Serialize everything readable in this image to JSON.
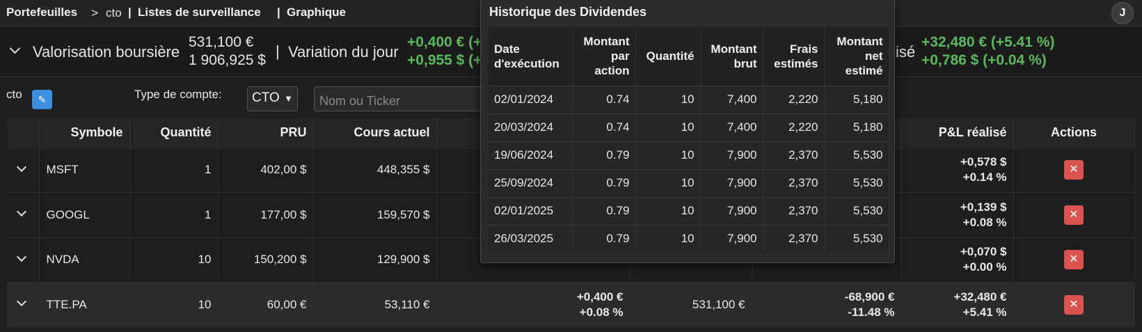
{
  "nav": {
    "portfolios": "Portefeuilles",
    "breadcrumb_sep": ">",
    "current": "cto",
    "divider": "|",
    "watchlists": "Listes de surveillance",
    "chart": "Graphique",
    "avatar": "J"
  },
  "summary": {
    "valuation_label": "Valorisation boursière",
    "valuation_eur": "531,100 €",
    "valuation_usd": "1 906,925 $",
    "divider": "|",
    "day_change_label": "Variation du jour",
    "day_change_eur": "+0,400 € (+",
    "day_change_usd": "+0,955 $ (+",
    "realized_label_tail": "isé",
    "realized_eur": "+32,480 € (+5.41 %)",
    "realized_usd": "+0,786 $ (+0.04 %)"
  },
  "filters": {
    "portfolio_name": "cto",
    "edit_icon": "pencil-icon",
    "account_type_label": "Type de compte:",
    "account_type_value": "CTO",
    "search_placeholder": "Nom ou Ticker"
  },
  "table": {
    "headers": {
      "symbol": "Symbole",
      "quantity": "Quantité",
      "pru": "PRU",
      "price": "Cours actuel",
      "realized": "P&L réalisé",
      "actions": "Actions"
    },
    "rows": [
      {
        "symbol": "MSFT",
        "quantity": "1",
        "pru": "402,00 $",
        "price": "448,355 $",
        "realized_1": "+0,578 $",
        "realized_2": "+0.14 %"
      },
      {
        "symbol": "GOOGL",
        "quantity": "1",
        "pru": "177,00 $",
        "price": "159,570 $",
        "realized_1": "+0,139 $",
        "realized_2": "+0.08 %"
      },
      {
        "symbol": "NVDA",
        "quantity": "10",
        "pru": "150,200 $",
        "price": "129,900 $",
        "realized_1": "+0,070 $",
        "realized_2": "+0.00 %"
      },
      {
        "symbol": "TTE.PA",
        "quantity": "10",
        "pru": "60,00 €",
        "price": "53,110 €",
        "day_1": "+0,400 €",
        "day_2": "+0.08 %",
        "value": "531,100 €",
        "unrealized_1": "-68,900 €",
        "unrealized_2": "-11.48 %",
        "realized_1": "+32,480 €",
        "realized_2": "+5.41 %"
      }
    ],
    "delete_glyph": "✕"
  },
  "dividends": {
    "title": "Historique des Dividendes",
    "headers": {
      "date_1": "Date",
      "date_2": "d'exécution",
      "per_share_1": "Montant",
      "per_share_2": "par",
      "per_share_3": "action",
      "quantity": "Quantité",
      "gross_1": "Montant",
      "gross_2": "brut",
      "fees_1": "Frais",
      "fees_2": "estimés",
      "net_1": "Montant",
      "net_2": "net",
      "net_3": "estimé"
    },
    "rows": [
      {
        "date": "02/01/2024",
        "per_share": "0.74",
        "quantity": "10",
        "gross": "7,400",
        "fees": "2,220",
        "net": "5,180"
      },
      {
        "date": "20/03/2024",
        "per_share": "0.74",
        "quantity": "10",
        "gross": "7,400",
        "fees": "2,220",
        "net": "5,180"
      },
      {
        "date": "19/06/2024",
        "per_share": "0.79",
        "quantity": "10",
        "gross": "7,900",
        "fees": "2,370",
        "net": "5,530"
      },
      {
        "date": "25/09/2024",
        "per_share": "0.79",
        "quantity": "10",
        "gross": "7,900",
        "fees": "2,370",
        "net": "5,530"
      },
      {
        "date": "02/01/2025",
        "per_share": "0.79",
        "quantity": "10",
        "gross": "7,900",
        "fees": "2,370",
        "net": "5,530"
      },
      {
        "date": "26/03/2025",
        "per_share": "0.79",
        "quantity": "10",
        "gross": "7,900",
        "fees": "2,370",
        "net": "5,530"
      }
    ]
  },
  "colors": {
    "positive": "#5cb85c",
    "negative": "#d9534f",
    "accent": "#3d8fe0"
  }
}
